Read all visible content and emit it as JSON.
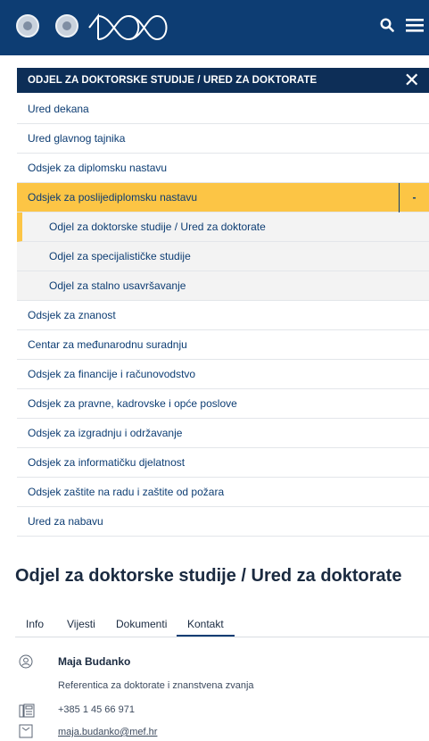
{
  "header": {
    "logo_icons": [
      "university-seal-icon",
      "faculty-seal-icon",
      "anniversary-100-logo"
    ],
    "search_icon": "search-icon",
    "menu_icon": "hamburger-menu-icon"
  },
  "panel": {
    "title": "ODJEL ZA DOKTORSKE STUDIJE / URED ZA DOKTORATE",
    "close_icon": "close-icon"
  },
  "menu": {
    "items": [
      {
        "label": "Ured dekana"
      },
      {
        "label": "Ured glavnog tajnika"
      },
      {
        "label": "Odsjek za diplomsku nastavu"
      },
      {
        "label": "Odsjek za poslijediplomsku nastavu",
        "toggle": "-"
      },
      {
        "label": "Odjel za doktorske studije / Ured za doktorate"
      },
      {
        "label": "Odjel za specijalističke studije"
      },
      {
        "label": "Odjel za stalno usavršavanje"
      },
      {
        "label": "Odsjek za znanost"
      },
      {
        "label": "Centar za međunarodnu suradnju"
      },
      {
        "label": "Odsjek za financije i računovodstvo"
      },
      {
        "label": "Odsjek za pravne, kadrovske i opće poslove"
      },
      {
        "label": "Odsjek za izgradnju i održavanje"
      },
      {
        "label": "Odsjek za informatičku djelatnost"
      },
      {
        "label": "Odsjek zaštite na radu i zaštite od požara"
      },
      {
        "label": "Ured za nabavu"
      }
    ]
  },
  "content": {
    "title": "Odjel za doktorske studije / Ured za doktorate",
    "tabs": [
      "Info",
      "Vijesti",
      "Dokumenti",
      "Kontakt"
    ],
    "selected_tab": "Kontakt"
  },
  "contact": {
    "name": "Maja Budanko",
    "role": "Referentica za doktorate i znanstvena zvanja",
    "phone": "+385 1 45 66 971",
    "email": "maja.budanko@mef.hr",
    "icons": [
      "person-icon",
      "phone-icon",
      "email-icon"
    ]
  },
  "colors": {
    "header_bg": "#0d3d73",
    "panel_title_bg": "#0d2e57",
    "active_bg": "#fcc545",
    "link": "#0d3d73"
  }
}
